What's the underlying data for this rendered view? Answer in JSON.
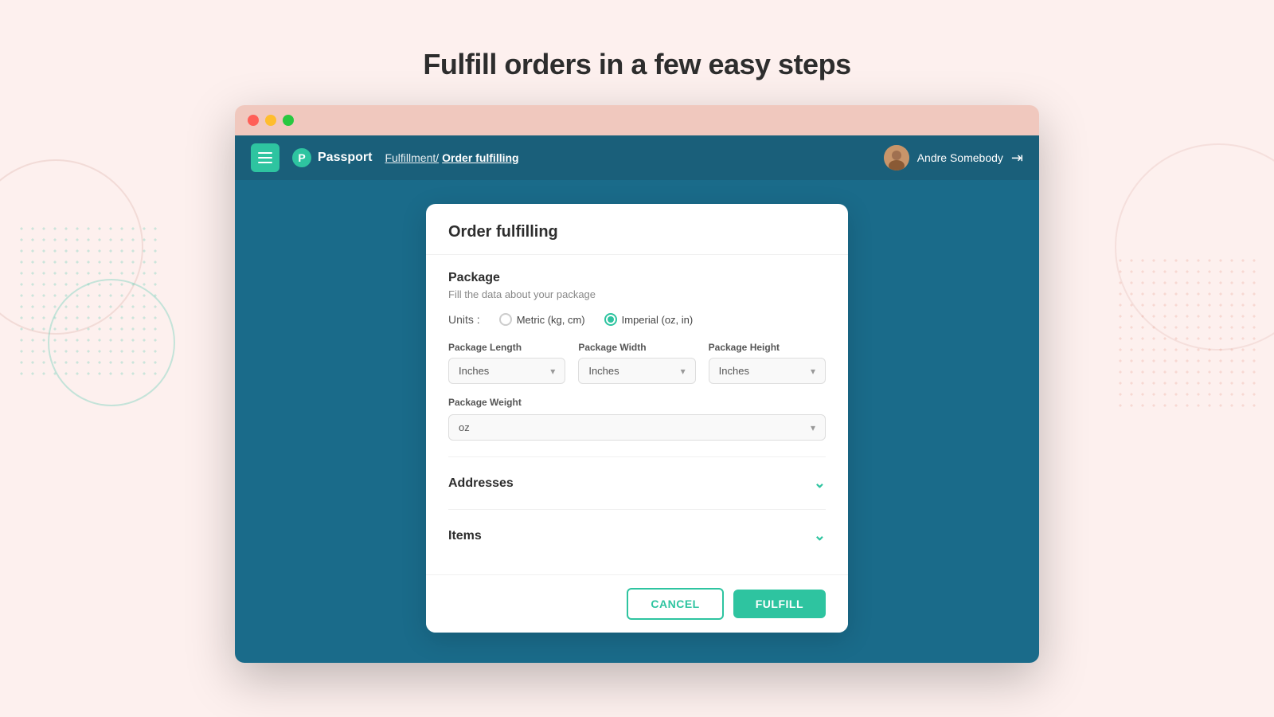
{
  "page": {
    "title": "Fulfill orders in a few easy steps",
    "background_color": "#fdf0ee"
  },
  "browser": {
    "dots": [
      "red",
      "yellow",
      "green"
    ]
  },
  "header": {
    "logo_text": "Passport",
    "logo_letter": "P",
    "breadcrumb_parent": "Fulfillment/",
    "breadcrumb_current": "Order fulfilling",
    "user_name": "Andre Somebody",
    "hamburger_label": "menu"
  },
  "dialog": {
    "title": "Order fulfilling",
    "package_section": {
      "title": "Package",
      "subtitle": "Fill the data about your package",
      "units_label": "Units :",
      "units_options": [
        {
          "id": "metric",
          "label": "Metric (kg, cm)",
          "selected": false
        },
        {
          "id": "imperial",
          "label": "Imperial (oz, in)",
          "selected": true
        }
      ],
      "fields": [
        {
          "id": "package_length",
          "label": "Package Length",
          "value": "Inches"
        },
        {
          "id": "package_width",
          "label": "Package Width",
          "value": "Inches"
        },
        {
          "id": "package_height",
          "label": "Package Height",
          "value": "Inches"
        }
      ],
      "weight_field": {
        "label": "Package Weight",
        "value": "oz"
      }
    },
    "addresses_section": {
      "title": "Addresses",
      "collapsed": true
    },
    "items_section": {
      "title": "Items",
      "collapsed": true
    },
    "footer": {
      "cancel_label": "CANCEL",
      "fulfill_label": "FULFILL"
    }
  }
}
